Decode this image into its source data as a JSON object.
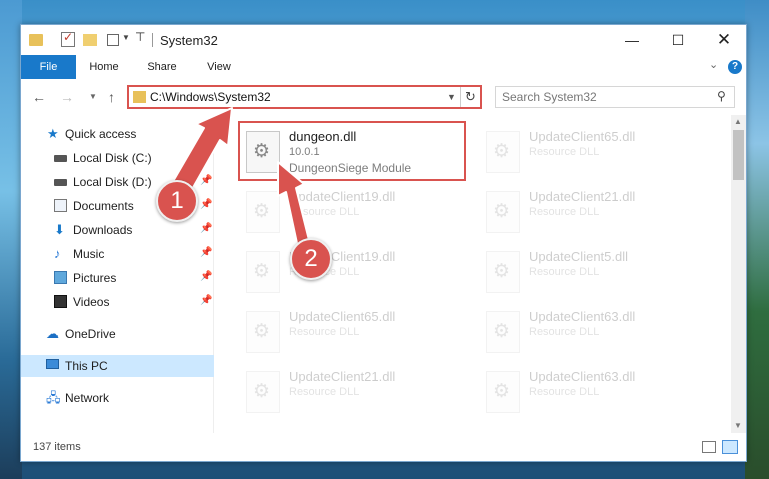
{
  "window": {
    "title": "System32",
    "controls": {
      "minimize": "—",
      "maximize": "☐",
      "close": "✕"
    }
  },
  "ribbon": {
    "tabs": [
      "File",
      "Home",
      "Share",
      "View"
    ],
    "help": "?"
  },
  "nav": {
    "address": "C:\\Windows\\System32",
    "search_placeholder": "Search System32"
  },
  "sidebar": {
    "items": [
      {
        "label": "Quick access",
        "icon": "star-icon"
      },
      {
        "label": "Local Disk (C:)",
        "icon": "drive-icon"
      },
      {
        "label": "Local Disk (D:)",
        "icon": "drive-icon"
      },
      {
        "label": "Documents",
        "icon": "documents-icon"
      },
      {
        "label": "Downloads",
        "icon": "downloads-icon"
      },
      {
        "label": "Music",
        "icon": "music-icon"
      },
      {
        "label": "Pictures",
        "icon": "pictures-icon"
      },
      {
        "label": "Videos",
        "icon": "videos-icon"
      },
      {
        "label": "OneDrive",
        "icon": "cloud-icon"
      },
      {
        "label": "This PC",
        "icon": "computer-icon"
      },
      {
        "label": "Network",
        "icon": "network-icon"
      }
    ],
    "selected": "This PC"
  },
  "files": [
    {
      "name": "dungeon.dll",
      "line1": "10.0.1",
      "line2": "DungeonSiege Module"
    },
    {
      "name": "UpdateClient65.dll",
      "line1": "Resource DLL"
    },
    {
      "name": "UpdateClient19.dll",
      "line1": "Resource DLL"
    },
    {
      "name": "UpdateClient21.dll",
      "line1": "Resource DLL"
    },
    {
      "name": "UpdateClient19.dll",
      "line1": "Resource DLL"
    },
    {
      "name": "UpdateClient5.dll",
      "line1": "Resource DLL"
    },
    {
      "name": "UpdateClient65.dll",
      "line1": "Resource DLL"
    },
    {
      "name": "UpdateClient63.dll",
      "line1": "Resource DLL"
    },
    {
      "name": "UpdateClient21.dll",
      "line1": "Resource DLL"
    },
    {
      "name": "UpdateClient63.dll",
      "line1": "Resource DLL"
    }
  ],
  "status": {
    "items_count": "137 items"
  },
  "callouts": {
    "first": "1",
    "second": "2"
  },
  "colors": {
    "accent": "#1979ca",
    "callout": "#d9534f",
    "selection": "#cce8ff"
  }
}
